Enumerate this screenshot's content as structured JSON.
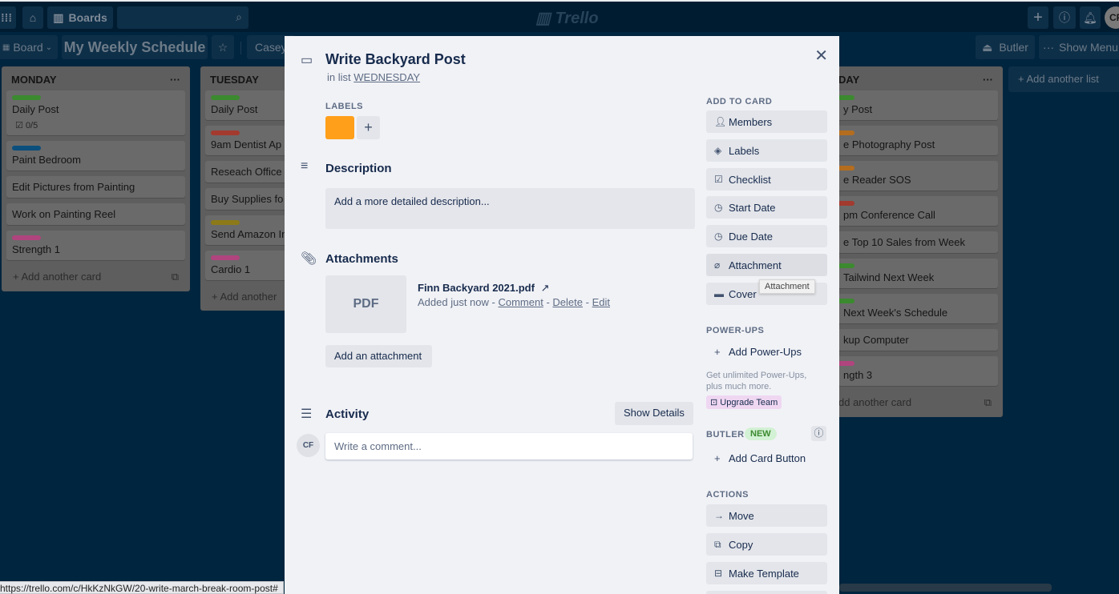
{
  "topbar": {
    "apps_icon": "grid-icon",
    "home_icon": "home-icon",
    "boards_label": "Boards",
    "search_placeholder": "",
    "logo": "Trello",
    "create_icon": "+",
    "info_icon": "ⓘ",
    "bell_icon": "bell-icon",
    "avatar_initials": "CF"
  },
  "boardbar": {
    "view_label": "Board",
    "board_title": "My Weekly Schedule",
    "star_icon": "☆",
    "team_label": "Casey",
    "butler_label": "Butler",
    "show_menu_label": "Show Menu"
  },
  "lists": [
    {
      "title": "MONDAY",
      "cards": [
        {
          "label_color": "#3c8a2f",
          "title": "Daily Post",
          "badge": "0/5"
        },
        {
          "label_color": "#0b4f7c",
          "title": "Paint Bedroom"
        },
        {
          "title": "Edit Pictures from Painting"
        },
        {
          "title": "Work on Painting Reel"
        },
        {
          "label_color": "#b0447e",
          "title": "Strength 1"
        }
      ],
      "add_card": "Add another card"
    },
    {
      "title": "TUESDAY",
      "cards": [
        {
          "label_color": "#3c8a2f",
          "title": "Daily Post"
        },
        {
          "label_color": "#a33a2f",
          "title": "9am Dentist Ap"
        },
        {
          "title": "Reseach Office"
        },
        {
          "title": "Buy Supplies fo"
        },
        {
          "label_color": "#8c7a19",
          "title": "Send Amazon In"
        },
        {
          "label_color": "#b0447e",
          "title": "Cardio 1"
        }
      ],
      "add_card": "Add another"
    },
    {
      "title": "DAY",
      "cards": [
        {
          "label_color": "#3c8a2f",
          "title": "y Post"
        },
        {
          "label_color": "#b46d1f",
          "title": "e Photography Post"
        },
        {
          "label_color": "#b46d1f",
          "title": "e Reader SOS"
        },
        {
          "label_color": "#a33a2f",
          "title": "pm Conference Call"
        },
        {
          "title": "e Top 10 Sales from Week"
        },
        {
          "label_color": "#3c8a2f",
          "title": "Tailwind Next Week"
        },
        {
          "label_color": "#3c8a2f",
          "title": "Next Week's Schedule"
        },
        {
          "title": "kup Computer"
        },
        {
          "label_color": "#b0447e",
          "title": "ngth 3"
        }
      ],
      "add_card": "dd another card"
    }
  ],
  "add_list": "Add another list",
  "modal": {
    "title": "Write Backyard Post",
    "in_list_prefix": "in list",
    "list_name": "WEDNESDAY",
    "labels_heading": "LABELS",
    "label_color": "#ff9f1a",
    "description_heading": "Description",
    "description_placeholder": "Add a more detailed description...",
    "attachments_heading": "Attachments",
    "attachment": {
      "thumb": "PDF",
      "name": "Finn Backyard 2021.pdf",
      "added": "Added just now -",
      "comment": "Comment",
      "delete": "Delete",
      "edit": "Edit",
      "sep": "-"
    },
    "add_attachment": "Add an attachment",
    "activity_heading": "Activity",
    "show_details": "Show Details",
    "commenter_initials": "CF",
    "comment_placeholder": "Write a comment...",
    "sidebar": {
      "add_to_card": "ADD TO CARD",
      "add_items": [
        {
          "icon": "person-icon",
          "label": "Members"
        },
        {
          "icon": "tag-icon",
          "label": "Labels"
        },
        {
          "icon": "checklist-icon",
          "label": "Checklist"
        },
        {
          "icon": "clock-icon",
          "label": "Start Date"
        },
        {
          "icon": "clock-icon",
          "label": "Due Date"
        },
        {
          "icon": "paperclip-icon",
          "label": "Attachment"
        },
        {
          "icon": "cover-icon",
          "label": "Cover"
        }
      ],
      "powerups_heading": "POWER-UPS",
      "add_powerups": "Add Power-Ups",
      "powerups_promo": "Get unlimited Power-Ups, plus much more.",
      "upgrade_team": "Upgrade Team",
      "butler_heading": "BUTLER",
      "butler_badge": "NEW",
      "add_card_button": "Add Card Button",
      "actions_heading": "ACTIONS",
      "actions": [
        {
          "icon": "arrow-right-icon",
          "label": "Move"
        },
        {
          "icon": "copy-icon",
          "label": "Copy"
        },
        {
          "icon": "template-icon",
          "label": "Make Template"
        }
      ]
    }
  },
  "tooltip": "Attachment",
  "status_url": "https://trello.com/c/HkKzNkGW/20-write-march-break-room-post#"
}
